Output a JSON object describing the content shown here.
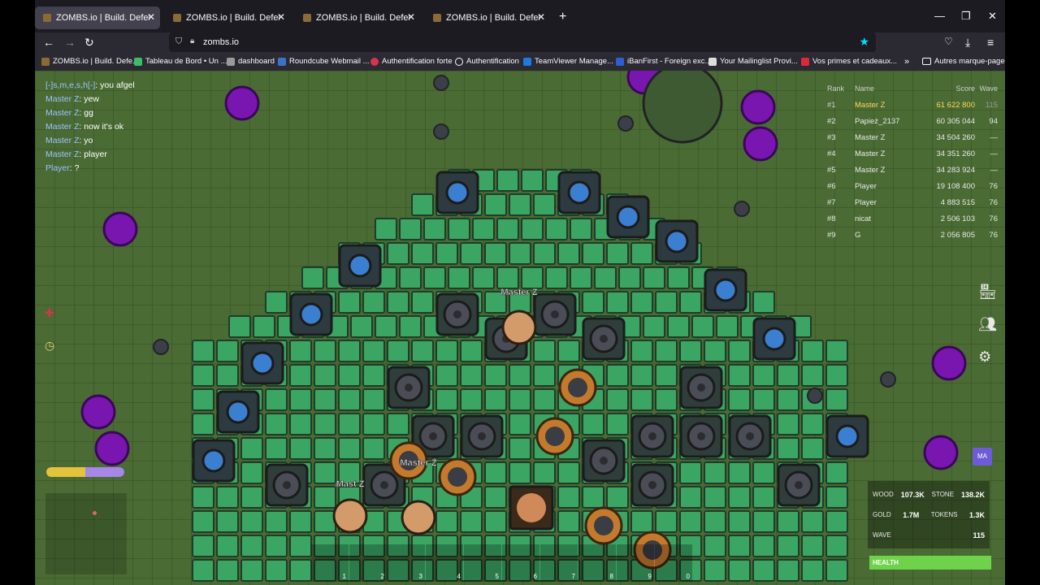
{
  "browser": {
    "tabs": [
      {
        "title": "ZOMBS.io | Build. Defend. Survive."
      },
      {
        "title": "ZOMBS.io | Build. Defend. Survive."
      },
      {
        "title": "ZOMBS.io | Build. Defend. Survive."
      },
      {
        "title": "ZOMBS.io | Build. Defend. Survive."
      }
    ],
    "url": "zombs.io",
    "bookmarks": [
      "ZOMBS.io | Build. Defe...",
      "Tableau de Bord • Un ...",
      "dashboard",
      "Roundcube Webmail ...",
      "Authentification forte",
      "Authentification",
      "TeamViewer Manage...",
      "iBanFirst - Foreign exc...",
      "Your Mailinglist Provi...",
      "Vos primes et cadeaux...",
      "Autres marque-pages"
    ]
  },
  "chat": [
    {
      "name": "[-]s,m,e,s,h[-]",
      "text": "you afgel"
    },
    {
      "name": "Master Z",
      "text": "yew"
    },
    {
      "name": "Master Z",
      "text": "gg"
    },
    {
      "name": "Master Z",
      "text": "now it's ok"
    },
    {
      "name": "Master Z",
      "text": "yo"
    },
    {
      "name": "Master Z",
      "text": "player"
    },
    {
      "name": "Player",
      "text": "?"
    }
  ],
  "leaderboard": {
    "headers": {
      "rank": "Rank",
      "name": "Name",
      "score": "Score",
      "wave": "Wave"
    },
    "rows": [
      {
        "rank": "#1",
        "name": "Master Z",
        "score": "61 622 800",
        "wave": "115"
      },
      {
        "rank": "#2",
        "name": "Papież_2137",
        "score": "60 305 044",
        "wave": "94"
      },
      {
        "rank": "#3",
        "name": "Master Z",
        "score": "34 504 260",
        "wave": "—"
      },
      {
        "rank": "#4",
        "name": "Master Z",
        "score": "34 351 260",
        "wave": "—"
      },
      {
        "rank": "#5",
        "name": "Master Z",
        "score": "34 283 924",
        "wave": "—"
      },
      {
        "rank": "#6",
        "name": "Player",
        "score": "19 108 400",
        "wave": "76"
      },
      {
        "rank": "#7",
        "name": "Player",
        "score": "4 883 515",
        "wave": "76"
      },
      {
        "rank": "#8",
        "name": "nicat",
        "score": "2 506 103",
        "wave": "76"
      },
      {
        "rank": "#9",
        "name": "G",
        "score": "2 056 805",
        "wave": "76"
      }
    ]
  },
  "players": {
    "label1": "Master Z",
    "label2": "Master Z",
    "label3": "Mast  Z"
  },
  "resources": {
    "wood_label": "WOOD",
    "wood": "107.3K",
    "stone_label": "STONE",
    "stone": "138.2K",
    "gold_label": "GOLD",
    "gold": "1.7M",
    "tokens_label": "TOKENS",
    "tokens": "1.3K",
    "wave_label": "WAVE",
    "wave": "115"
  },
  "health": {
    "label": "HEALTH",
    "level": 1.0
  },
  "party_button": "MA",
  "hotbar": [
    "1",
    "2",
    "3",
    "4",
    "5",
    "6",
    "7",
    "8",
    "9",
    "0"
  ],
  "colors": {
    "grass": "#4a6b33",
    "wall": "#3ba664",
    "turret": "#3a7fd0",
    "zombie": "#7a16b0",
    "health": "#6fd24b"
  }
}
